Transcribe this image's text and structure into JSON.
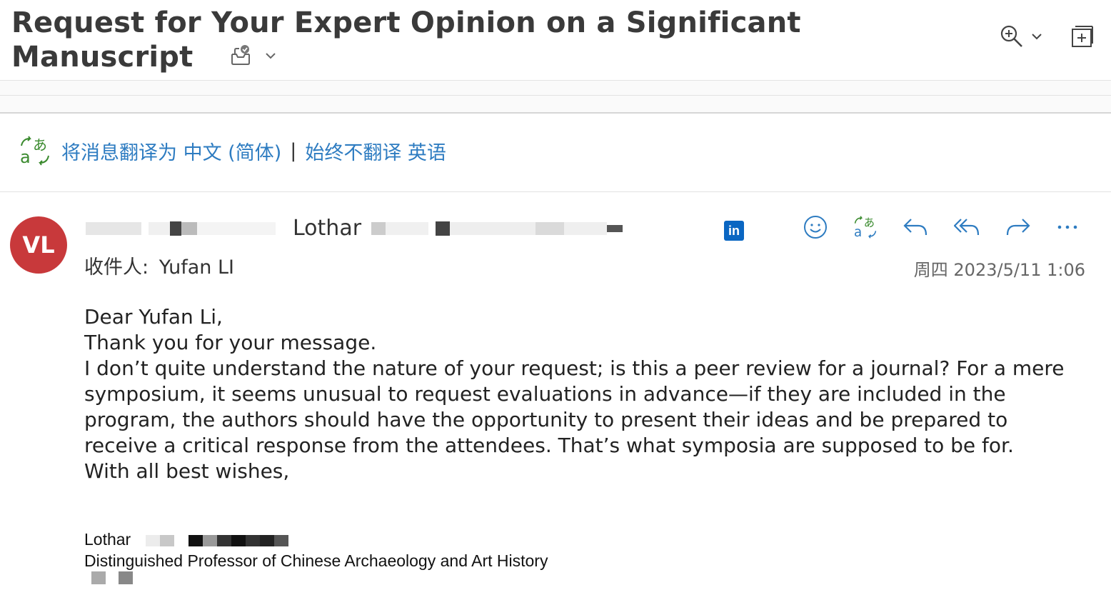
{
  "subject": {
    "title": "Request for Your Expert Opinion on a Significant Manuscript"
  },
  "translation_bar": {
    "translate_label": "将消息翻译为 中文 (简体)",
    "separator": "|",
    "never_translate_label": "始终不翻译 英语"
  },
  "message": {
    "avatar_initials": "VL",
    "avatar_color": "#c8393b",
    "sender_name_visible": "Lothar",
    "recipients_label": "收件人:",
    "recipients": "Yufan LI",
    "date": "周四 2023/5/11 1:06",
    "body": [
      "Dear Yufan Li,",
      "Thank you for your message.",
      "I don’t quite understand the nature of your request; is this a peer review for a journal? For a mere symposium, it seems unusual to request evaluations in advance—if they are included in the program, the authors should have the opportunity to present their ideas and be prepared to receive a critical response from the attendees.  That’s what symposia are supposed to be for.",
      "With all best wishes,"
    ],
    "signature": {
      "name": "Lothar",
      "title": "Distinguished Professor of Chinese Archaeology and Art History"
    }
  },
  "icons": {
    "zoom": "zoom-in-icon",
    "expand": "expand-icon",
    "inbox_check": "inbox-check-icon",
    "translate": "translate-icon",
    "emoji": "emoji-icon",
    "reply": "reply-icon",
    "reply_all": "reply-all-icon",
    "forward": "forward-icon",
    "more": "more-icon",
    "linkedin": "linkedin-icon"
  },
  "colors": {
    "link": "#2e7cc1",
    "translate_green": "#3a8a2e",
    "linkedin": "#0a66c2"
  }
}
